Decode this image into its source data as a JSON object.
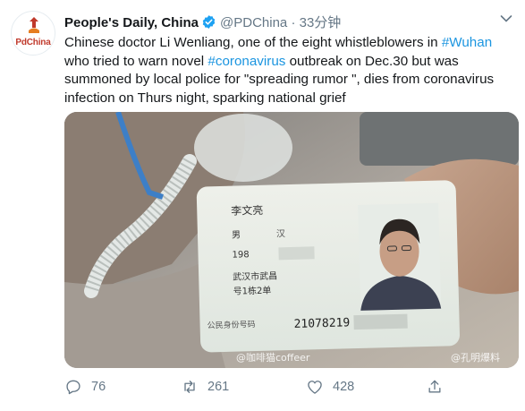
{
  "tweet": {
    "author_name": "People's Daily, China",
    "handle": "@PDChina",
    "separator": "·",
    "time": "33分钟",
    "avatar_brand": "PdChina",
    "text_segments": [
      "Chinese doctor Li Wenliang, one of the eight whistleblowers in ",
      "#Wuhan",
      " who tried to warn novel ",
      "#coronavirus",
      " outbreak on Dec.30 but was summoned by local police for \"spreading rumor \", dies from coronavirus infection on Thurs night, sparking national grief"
    ],
    "hashtag_color": "#1b95e0",
    "verified_color": "#1da1f2"
  },
  "media": {
    "id_card": {
      "name": "李文亮",
      "gender": "男",
      "ethnicity": "汉",
      "birth_year": "198",
      "address_line1": "武汉市武昌",
      "address_line2": "号1栋2单",
      "id_label": "公民身份号码",
      "id_number": "21078219"
    },
    "watermarks": [
      "@咖啡猫coffeer",
      "@孔明爆料"
    ]
  },
  "actions": {
    "replies": "76",
    "retweets": "261",
    "likes": "428"
  }
}
